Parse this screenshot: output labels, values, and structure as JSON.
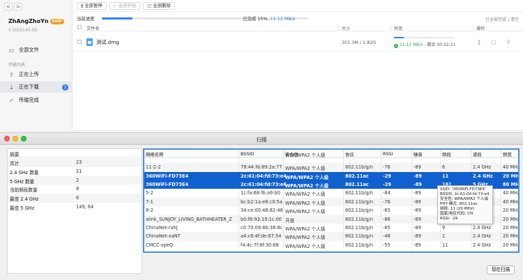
{
  "app": {
    "nav": {
      "back": "<",
      "forward": ">"
    },
    "user": {
      "name": "ZhAngZhoYn",
      "vip": "SVIP",
      "storage": "5.5G/5140.0G"
    },
    "sidebar": {
      "all_files": "全部文件",
      "section_label": "传输列表",
      "uploading": "正在上传",
      "downloading": "正在下载",
      "downloading_count": "1",
      "completed": "传输完成"
    },
    "toolbar": {
      "pause_all": "全部暂停",
      "start_all": "全部开始",
      "delete_all": "全部删除"
    },
    "progress": {
      "label": "当前进度",
      "percent": 15,
      "text": "已完成 15%,",
      "speed": "11.12 MB/s",
      "clear": "已全部完成 | 清空"
    },
    "columns": {
      "name": "文件名",
      "size": "大小",
      "status": "状态",
      "ops": "操作"
    },
    "download": {
      "name": "测试.dmg",
      "size": "301.3M / 1.82G",
      "progress": 0.16,
      "speed": "11.12 MB/s",
      "remaining": "- 剩余 00:02:21"
    }
  },
  "scan": {
    "title": "扫描",
    "summary": {
      "header": "摘要",
      "rows": [
        {
          "k": "共计",
          "v": "23"
        },
        {
          "k": "2.4 GHz 数量",
          "v": "21"
        },
        {
          "k": "5 GHz 数量",
          "v": "2"
        },
        {
          "k": "当前频段数量",
          "v": "8"
        },
        {
          "k": "最佳 2.4 GHz",
          "v": "6"
        },
        {
          "k": "最佳 5 GHz",
          "v": "149, 64"
        }
      ]
    },
    "columns": [
      "网络名称",
      "BSSID",
      "安全性",
      "协议",
      "RSSI",
      "噪音",
      "频段",
      "波段",
      "频宽"
    ],
    "rows": [
      {
        "name": "",
        "bssid": "",
        "sec": "WPA/WPA2 个人级",
        "proto": "",
        "rssi": "",
        "noise": "",
        "ch": "",
        "band": "",
        "width": "",
        "sel": false
      },
      {
        "name": "11-2-2",
        "bssid": "78:44:fd:89:2a:77",
        "sec": "WPA/WPA2 个人级",
        "proto": "802.11b/g/n",
        "rssi": "-76",
        "noise": "-89",
        "ch": "6",
        "band": "2.4 GHz",
        "width": "40 MHz",
        "sel": false
      },
      {
        "name": "360WiFi-FD73E4",
        "bssid": "2c:61:04:fd:73:e4",
        "sec": "WPA/WPA2 个人级",
        "proto": "802.11ac",
        "rssi": "-29",
        "noise": "-89",
        "ch": "11",
        "band": "2.4 GHz",
        "width": "20 MHz",
        "sel": true
      },
      {
        "name": "360WiFi-FD73E4",
        "bssid": "2c:61:04:fd:73:e6",
        "sec": "WPA/WPA2 个人级",
        "proto": "802.11ac",
        "rssi": "-29",
        "noise": "-89",
        "ch": "161",
        "band": "5 GHz",
        "width": "80 MHz",
        "sel": true
      },
      {
        "name": "5-2",
        "bssid": "1c:fa:68:fb:a9:b0",
        "sec": "WPA/WPA2 个人级",
        "proto": "802.11b/g/n",
        "rssi": "-84",
        "noise": "-89",
        "ch": "",
        "band": "",
        "width": "40 MHz",
        "sel": false
      },
      {
        "name": "7-1",
        "bssid": "bc:b2:1a:e8:c0:5a",
        "sec": "WPA/WPA2 个人级",
        "proto": "802.11b/g/n",
        "rssi": "-76",
        "noise": "-89",
        "ch": "",
        "band": "",
        "width": "40 MHz",
        "sel": false
      },
      {
        "name": "8-2",
        "bssid": "34:ce:00:48:82:48",
        "sec": "WPA/WPA2 个人级",
        "proto": "802.11b/g/n",
        "rssi": "-65",
        "noise": "-89",
        "ch": "",
        "band": "",
        "width": "20 MHz",
        "sel": false
      },
      {
        "name": "alink_SUNJOY_LIVING_BATHHEATER_Z",
        "bssid": "b0:f8:93:19:1c:00",
        "sec": "开放",
        "proto": "802.11b/g/n",
        "rssi": "-86",
        "noise": "-89",
        "ch": "",
        "band": "",
        "width": "20 MHz",
        "sel": false
      },
      {
        "name": "ChinaNet-rahJ",
        "bssid": "c0:70:09:8b:38:8c",
        "sec": "WPA/WPA2 个人级",
        "proto": "802.11b/g/n",
        "rssi": "-85",
        "noise": "-89",
        "ch": "9",
        "band": "2.4 GHz",
        "width": "20 MHz",
        "sel": false
      },
      {
        "name": "ChinaNet-xaNT",
        "bssid": "a4:c6:4f:de:67:54",
        "sec": "WPA/WPA2 个人级",
        "proto": "802.11b/g/n",
        "rssi": "-46",
        "noise": "-89",
        "ch": "1",
        "band": "2.4 GHz",
        "width": "20 MHz",
        "sel": false
      },
      {
        "name": "CMCC-vpeQ",
        "bssid": "f4:4c:7f:8f:30:68",
        "sec": "WPA/WPA2 个人级",
        "proto": "802.11b/g/n",
        "rssi": "-55",
        "noise": "-89",
        "ch": "11",
        "band": "2.4 GHz",
        "width": "20 MHz",
        "sel": false
      }
    ],
    "tooltip": [
      "SSID: '360WiFi-FD73E4'",
      "BSSID: 2c:61:04:fd:73:e4",
      "安全性: WPA/WPA2 个人级",
      "PHY 模式: 802.11ac",
      "频段: 11 (20 MHz)",
      "国家/地区代码: CN",
      "RSSI: -29"
    ],
    "rescan": "现在扫描"
  },
  "colors": {
    "accent": "#2f80ed",
    "selection": "#1060d0",
    "speed_green": "#2bb24c",
    "table_border": "#4a8fd6"
  }
}
